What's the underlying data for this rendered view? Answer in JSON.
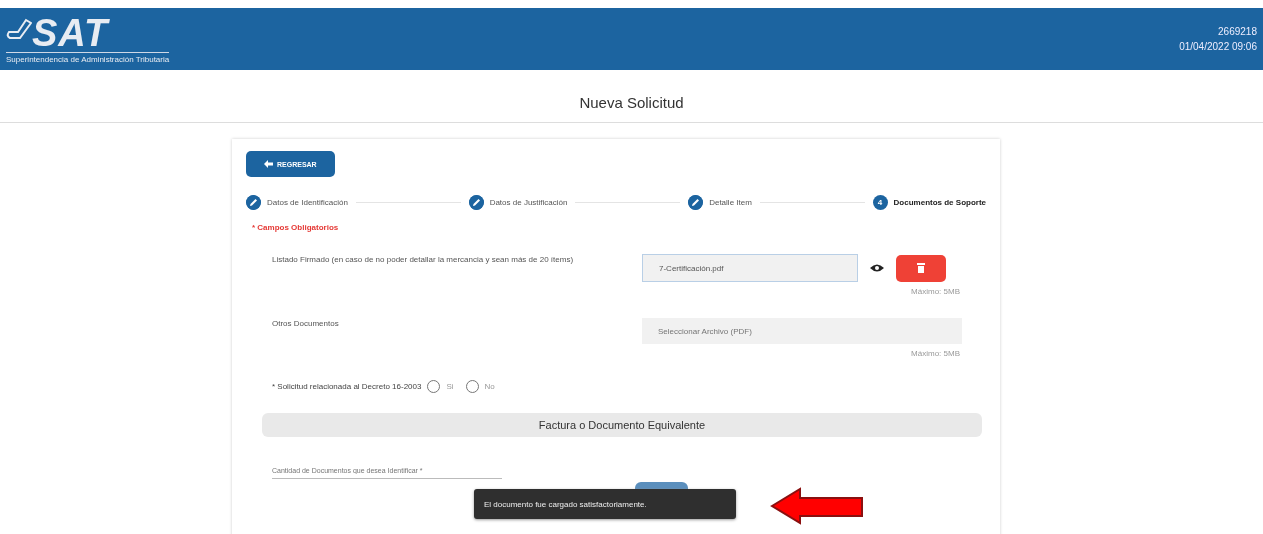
{
  "header": {
    "logo_text": "SAT",
    "logo_subtitle": "Superintendencia de Administración Tributaria",
    "user_id": "2669218",
    "datetime": "01/04/2022 09:06"
  },
  "page_title": "Nueva Solicitud",
  "back_button": "REGRESAR",
  "steps": [
    {
      "label": "Datos de Identificación",
      "completed": true,
      "selected": false
    },
    {
      "label": "Datos de Justificación",
      "completed": true,
      "selected": false
    },
    {
      "label": "Detalle Item",
      "completed": true,
      "selected": false
    },
    {
      "label": "Documentos de Soporte",
      "completed": false,
      "selected": true,
      "number": "4"
    }
  ],
  "required_note": "* Campos Obligatorios",
  "documents": [
    {
      "label": "Listado Firmado (en caso de no poder detallar la mercancia y sean más de 20 ítems)",
      "value": "7-Certificación.pdf",
      "uploaded": true,
      "max_note": "Máximo: 5MB"
    },
    {
      "label": "Otros Documentos",
      "placeholder": "Seleccionar Archivo (PDF)",
      "uploaded": false,
      "max_note": "Máximo: 5MB"
    }
  ],
  "decree_question": {
    "label": "* Solicitud relacionada al Decreto 16-2003",
    "options": [
      {
        "label": "Si",
        "selected": false
      },
      {
        "label": "No",
        "selected": false
      }
    ]
  },
  "section_title": "Factura o Documento Equivalente",
  "quantity_field": {
    "placeholder": "Cantidad de Documentos que desea Identificar *"
  },
  "toast": "El documento fue cargado satisfactoriamente."
}
